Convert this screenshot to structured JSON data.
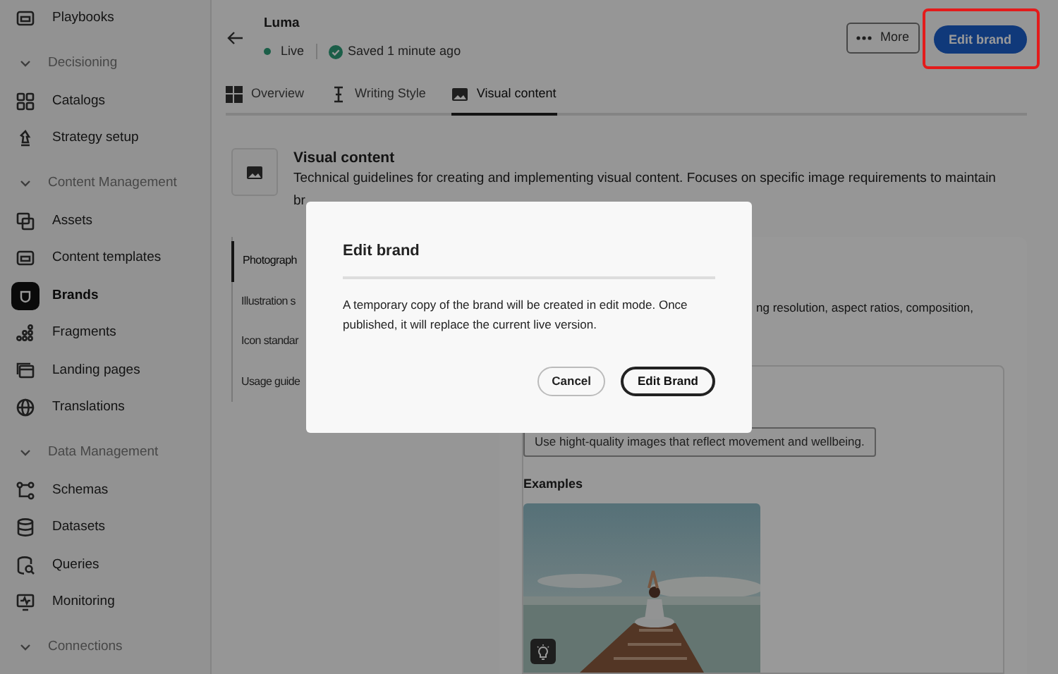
{
  "sidebar": {
    "items": [
      {
        "kind": "item",
        "label": "Playbooks",
        "selected": false
      },
      {
        "kind": "section",
        "label": "Decisioning",
        "expanded": true
      },
      {
        "kind": "item",
        "label": "Catalogs",
        "selected": false
      },
      {
        "kind": "item",
        "label": "Strategy setup",
        "selected": false
      },
      {
        "kind": "section",
        "label": "Content Management",
        "expanded": true
      },
      {
        "kind": "item",
        "label": "Assets",
        "selected": false
      },
      {
        "kind": "item",
        "label": "Content templates",
        "selected": false
      },
      {
        "kind": "item",
        "label": "Brands",
        "selected": true
      },
      {
        "kind": "item",
        "label": "Fragments",
        "selected": false
      },
      {
        "kind": "item",
        "label": "Landing pages",
        "selected": false
      },
      {
        "kind": "item",
        "label": "Translations",
        "selected": false
      },
      {
        "kind": "section",
        "label": "Data Management",
        "expanded": true
      },
      {
        "kind": "item",
        "label": "Schemas",
        "selected": false
      },
      {
        "kind": "item",
        "label": "Datasets",
        "selected": false
      },
      {
        "kind": "item",
        "label": "Queries",
        "selected": false
      },
      {
        "kind": "item",
        "label": "Monitoring",
        "selected": false
      },
      {
        "kind": "section",
        "label": "Connections",
        "expanded": true
      }
    ]
  },
  "header": {
    "title": "Luma",
    "status": "Live",
    "saved": "Saved 1 minute ago",
    "more_button": "More",
    "edit_button": {
      "label": "Edit brand",
      "highlighted": true
    }
  },
  "tabs": [
    {
      "label": "Overview",
      "selected": false
    },
    {
      "label": "Writing Style",
      "selected": false
    },
    {
      "label": "Visual content",
      "selected": true
    }
  ],
  "section": {
    "title": "Visual content",
    "description": "Technical guidelines for creating and implementing visual content. Focuses on specific image requirements to maintain",
    "description_line_2": "br"
  },
  "subnav": [
    {
      "label": "Photograph",
      "selected": true
    },
    {
      "label": "Illustration s",
      "selected": false
    },
    {
      "label": "Icon standar",
      "selected": false
    },
    {
      "label": "Usage guide",
      "selected": false
    }
  ],
  "detail": {
    "text_fragment": "ng resolution, aspect ratios, composition,",
    "guideline": "Use hight-quality images that reflect movement and wellbeing.",
    "examples_label": "Examples"
  },
  "dialog": {
    "title": "Edit brand",
    "body": "A temporary copy of the brand will be created in edit mode. Once published, it will replace the current live version.",
    "buttons": [
      {
        "label": "Cancel",
        "kind": "secondary"
      },
      {
        "label": "Edit Brand",
        "kind": "primary"
      }
    ]
  }
}
